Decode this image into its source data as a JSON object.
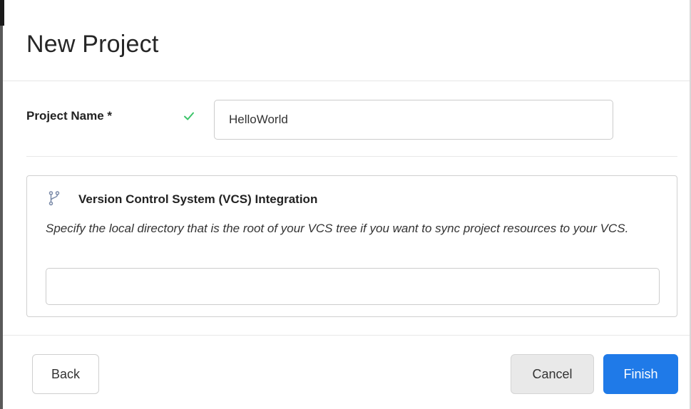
{
  "dialog": {
    "title": "New Project"
  },
  "project_name": {
    "label": "Project Name *",
    "value": "HelloWorld",
    "status_icon": "check-icon",
    "status_color": "#3cc46a"
  },
  "vcs": {
    "icon": "branch-icon",
    "title": "Version Control System (VCS) Integration",
    "description": "Specify the local directory that is the root of your VCS tree if you want to sync project resources to your VCS.",
    "directory_value": ""
  },
  "footer": {
    "back_label": "Back",
    "cancel_label": "Cancel",
    "finish_label": "Finish",
    "primary_color": "#1f7ae8"
  }
}
